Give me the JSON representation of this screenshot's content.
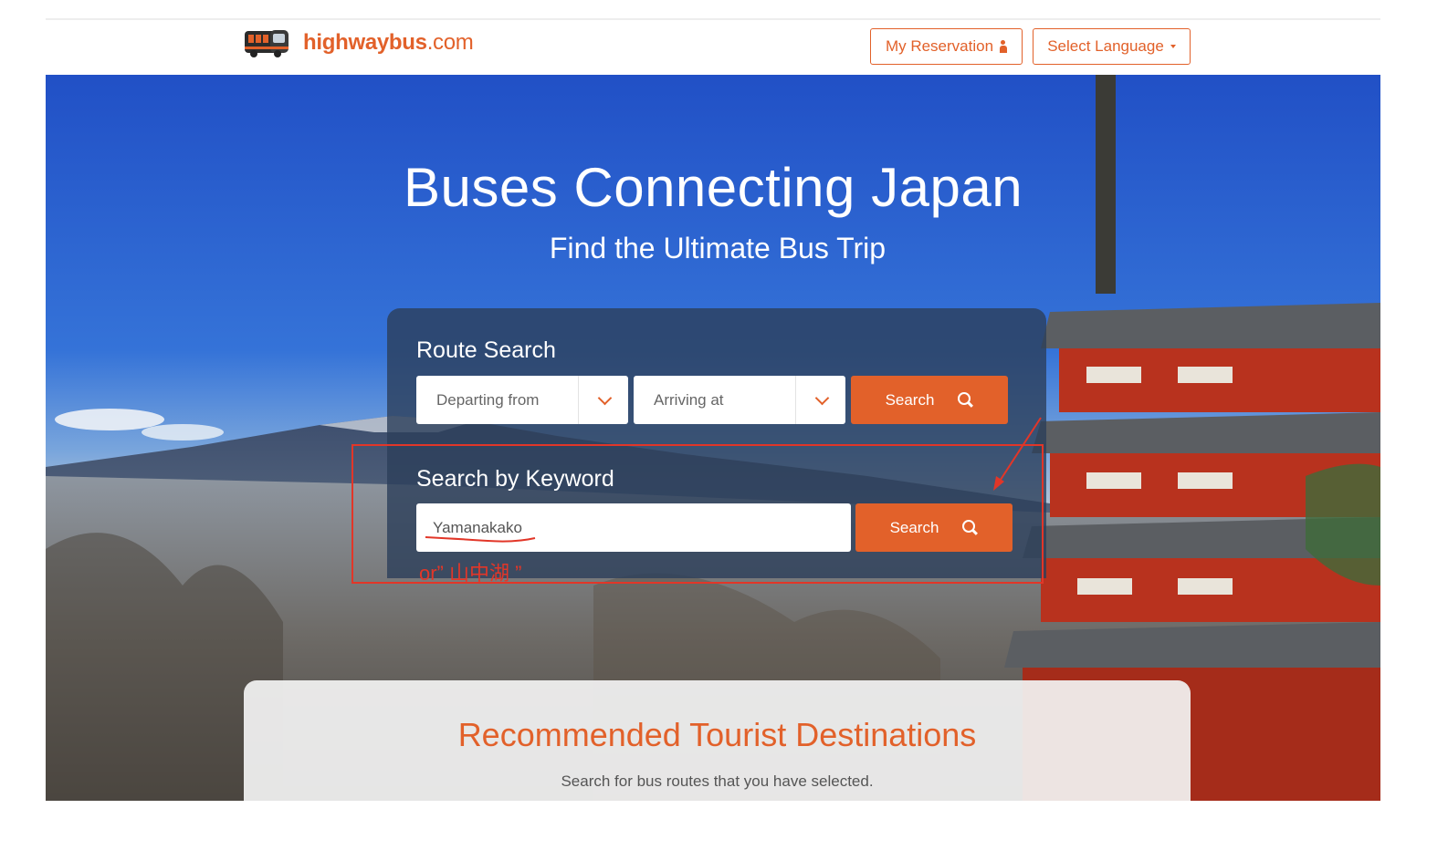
{
  "header": {
    "logo_bold": "highwaybus",
    "logo_thin": ".com",
    "reservation_label": "My Reservation",
    "language_label": "Select Language"
  },
  "hero": {
    "title": "Buses Connecting Japan",
    "subtitle": "Find the Ultimate Bus Trip"
  },
  "route_search": {
    "title": "Route Search",
    "departing_placeholder": "Departing from",
    "arriving_placeholder": "Arriving at",
    "search_label": "Search"
  },
  "keyword_search": {
    "title": "Search by Keyword",
    "input_value": "Yamanakako",
    "search_label": "Search"
  },
  "annotation": {
    "note": "or” 山中湖 ”"
  },
  "recommended": {
    "title": "Recommended Tourist Destinations",
    "subtitle": "Search for bus routes that you have selected."
  },
  "colors": {
    "accent": "#e2612a",
    "annotation": "#e23628",
    "panel": "#2c3e5a"
  },
  "icons": [
    "bus-logo-icon",
    "person-icon",
    "caret-down-icon",
    "chevron-down-icon",
    "search-icon"
  ]
}
